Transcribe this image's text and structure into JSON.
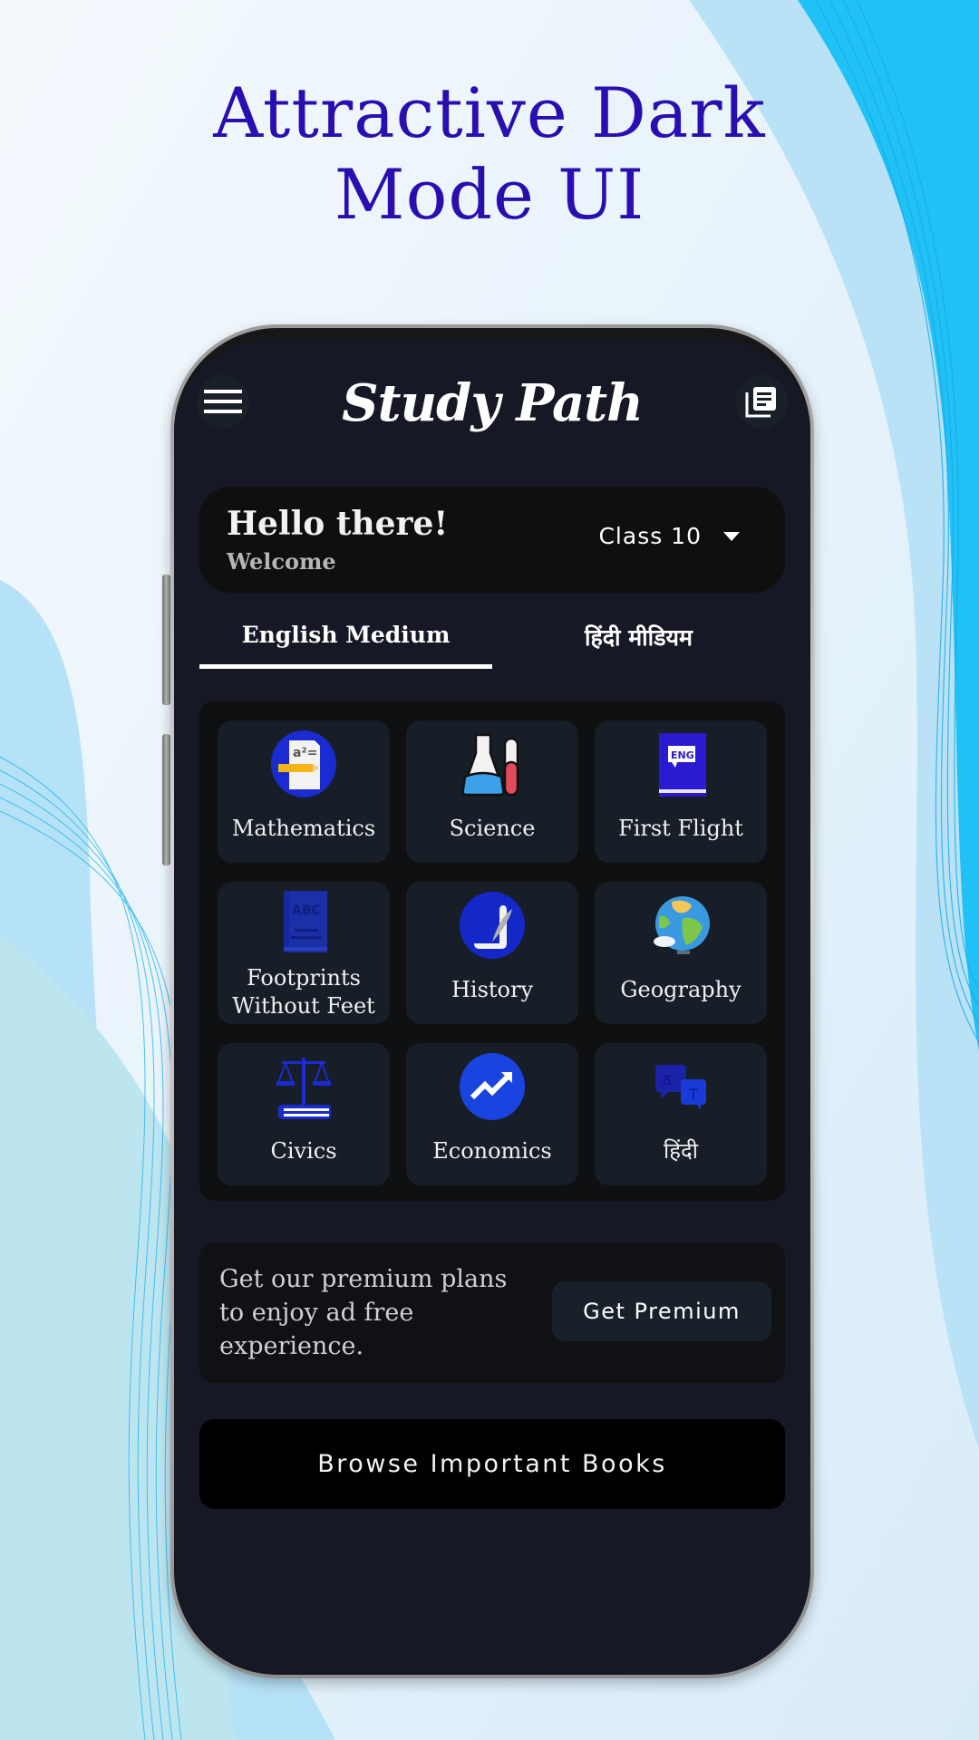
{
  "headline": {
    "line1": "Attractive Dark",
    "line2": "Mode UI"
  },
  "colors": {
    "headline": "#2a0fb0",
    "screen_bg": "#161925",
    "card_bg": "#181e27",
    "accent_blue": "#1a2bd0"
  },
  "header": {
    "title": "Study Path",
    "menu_icon": "hamburger-menu-icon",
    "right_icon": "library-books-icon"
  },
  "greeting": {
    "title": "Hello there!",
    "subtitle": "Welcome"
  },
  "class_select": {
    "selected": "Class 10"
  },
  "tabs": [
    {
      "label": "English Medium",
      "active": true
    },
    {
      "label": "हिंदी मीडियम",
      "active": false
    }
  ],
  "subjects": [
    {
      "label": "Mathematics",
      "icon": "math-icon"
    },
    {
      "label": "Science",
      "icon": "flask-icon"
    },
    {
      "label": "First Flight",
      "icon": "english-book-icon"
    },
    {
      "label": "Footprints Without Feet",
      "icon": "abc-book-icon"
    },
    {
      "label": "History",
      "icon": "scroll-quill-icon"
    },
    {
      "label": "Geography",
      "icon": "globe-icon"
    },
    {
      "label": "Civics",
      "icon": "justice-scale-icon"
    },
    {
      "label": "Economics",
      "icon": "trend-up-icon"
    },
    {
      "label": "हिंदी",
      "icon": "translate-icon"
    }
  ],
  "premium": {
    "text": "Get our premium plans to enjoy ad free experience.",
    "button": "Get Premium"
  },
  "browse": {
    "label": "Browse Important Books"
  }
}
